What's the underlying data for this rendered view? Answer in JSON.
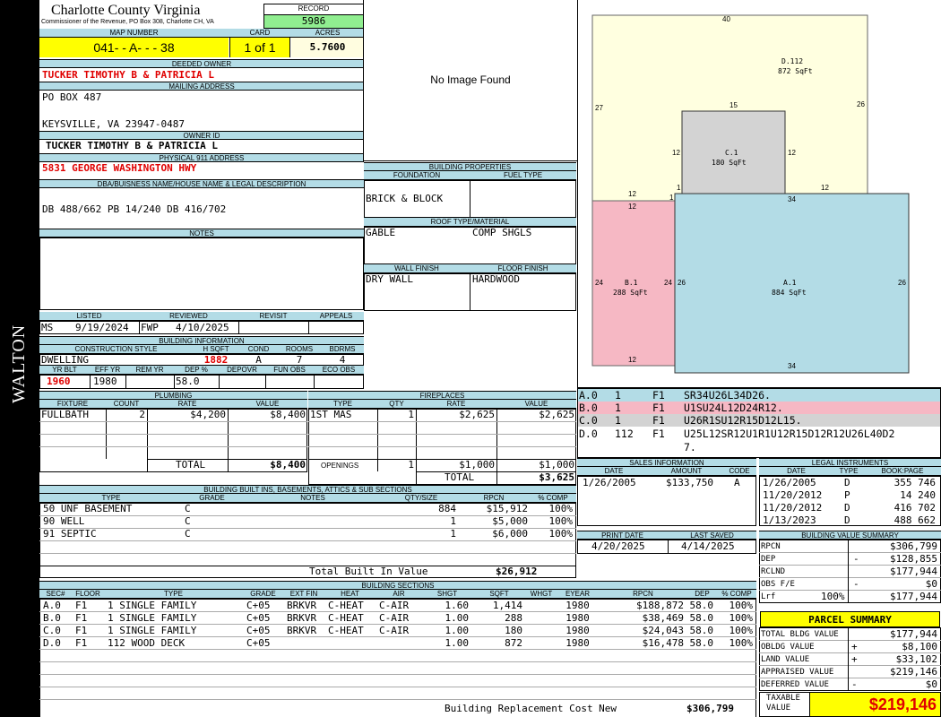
{
  "side_label": "WALTON",
  "header": {
    "county": "Charlotte County Virginia",
    "sub": "Commissioner of the Revenue, PO Box 308, Charlotte CH, VA",
    "record_label": "RECORD",
    "record": "5986"
  },
  "parcel": {
    "map_label": "MAP NUMBER",
    "map": "041- - A- - - 38",
    "card_label": "CARD",
    "card": "1 of 1",
    "acres_label": "ACRES",
    "acres": "5.7600"
  },
  "owner": {
    "deeded_label": "DEEDED OWNER",
    "deeded": "TUCKER TIMOTHY B & PATRICIA L",
    "mailing_label": "MAILING ADDRESS",
    "mail1": "PO BOX 487",
    "mail2": "KEYSVILLE, VA 23947-0487",
    "owner_id_label": "OWNER ID",
    "owner_id": "TUCKER TIMOTHY B & PATRICIA L",
    "phys_label": "PHYSICAL 911 ADDRESS",
    "phys": "5831 GEORGE WASHINGTON HWY",
    "dba_label": "DBA/BUISNESS NAME/HOUSE NAME & LEGAL DESCRIPTION",
    "dba": "DB 488/662 PB 14/240 DB 416/702",
    "notes_label": "NOTES"
  },
  "image": {
    "missing": "No Image Found"
  },
  "listing": {
    "listed_label": "LISTED",
    "reviewed_label": "REVIEWED",
    "revisit_label": "REVISIT",
    "appeals_label": "APPEALS",
    "listed_by": "MS",
    "listed_date": "9/19/2024",
    "reviewed_by": "FWP",
    "reviewed_date": "4/10/2025"
  },
  "bldg_info": {
    "title": "BUILDING INFORMATION",
    "h": [
      "CONSTRUCTION STYLE",
      "H SQFT",
      "COND",
      "ROOMS",
      "BDRMS"
    ],
    "style": "DWELLING",
    "sqft": "1882",
    "cond": "A",
    "rooms": "7",
    "bdrms": "4",
    "h2": [
      "YR BLT",
      "EFF YR",
      "REM YR",
      "DEP %",
      "DEPOVR",
      "FUN OBS",
      "ECO OBS"
    ],
    "yrblt": "1960",
    "effyr": "1980",
    "dep": "58.0"
  },
  "props": {
    "title": "BUILDING PROPERTIES",
    "foundation_label": "FOUNDATION",
    "fuel_label": "FUEL TYPE",
    "foundation": "BRICK & BLOCK",
    "roof_label": "ROOF TYPE/MATERIAL",
    "roof_type": "GABLE",
    "roof_mat": "COMP SHGLS",
    "wall_label": "WALL FINISH",
    "floor_label": "FLOOR FINISH",
    "wall": "DRY WALL",
    "floor": "HARDWOOD"
  },
  "sketch": {
    "D": {
      "label": "D.112",
      "area": "872 SqFt",
      "top": "40",
      "left": "27",
      "right": "26",
      "b1": "12",
      "b2": "12"
    },
    "C": {
      "label": "C.1",
      "area": "180 SqFt",
      "top": "15",
      "left": "12",
      "right": "12",
      "bl": "1"
    },
    "B": {
      "label": "B.1",
      "area": "288 SqFt",
      "top": "12",
      "left": "24",
      "right": "24",
      "bottom": "12",
      "tr": "1"
    },
    "A": {
      "label": "A.1",
      "area": "884 SqFt",
      "top": "34",
      "left": "26",
      "right": "26",
      "bottom": "34"
    }
  },
  "sections_list": [
    {
      "id": "A.0",
      "n": "1",
      "fl": "F1",
      "code": "SR34U26L34D26.",
      "bg": "#b3dce6"
    },
    {
      "id": "B.0",
      "n": "1",
      "fl": "F1",
      "code": "U1SU24L12D24R12.",
      "bg": "#f6b8c4"
    },
    {
      "id": "C.0",
      "n": "1",
      "fl": "F1",
      "code": "U26R1SU12R15D12L15.",
      "bg": "#d3d3d3"
    },
    {
      "id": "D.0",
      "n": "112",
      "fl": "F1",
      "code": "U25L12SR12U1R1U12R15D12R12U26L40D2",
      "code2": "7.",
      "bg": "#ffffff"
    }
  ],
  "plumbing": {
    "title": "PLUMBING",
    "h": [
      "FIXTURE",
      "COUNT",
      "RATE",
      "VALUE"
    ],
    "row": [
      "FULLBATH",
      "2",
      "$4,200",
      "$8,400"
    ],
    "total_label": "TOTAL",
    "total": "$8,400"
  },
  "fireplaces": {
    "title": "FIREPLACES",
    "h": [
      "TYPE",
      "QTY",
      "RATE",
      "VALUE"
    ],
    "row": [
      "1ST MAS",
      "1",
      "$2,625",
      "$2,625"
    ],
    "open_label": "OPENINGS",
    "open": [
      "1",
      "$1,000",
      "$1,000"
    ],
    "total_label": "TOTAL",
    "total": "$3,625"
  },
  "sales": {
    "title": "SALES INFORMATION",
    "h": [
      "DATE",
      "AMOUNT",
      "CODE"
    ],
    "row": [
      "1/26/2005",
      "$133,750",
      "A"
    ]
  },
  "legal": {
    "title": "LEGAL INSTRUMENTS",
    "h": [
      "DATE",
      "TYPE",
      "BOOK:PAGE"
    ],
    "rows": [
      [
        "1/26/2005",
        "D",
        "355 746"
      ],
      [
        "11/20/2012",
        "P",
        "14 240"
      ],
      [
        "11/20/2012",
        "D",
        "416 702"
      ],
      [
        "1/13/2023",
        "D",
        "488 662"
      ]
    ]
  },
  "builtins": {
    "title": "BUILDING BUILT INS, BASEMENTS, ATTICS & SUB SECTIONS",
    "h": [
      "TYPE",
      "GRADE",
      "NOTES",
      "QTY/SIZE",
      "RPCN",
      "% COMP"
    ],
    "rows": [
      [
        "50 UNF BASEMENT",
        "C",
        "",
        "884",
        "$15,912",
        "100%"
      ],
      [
        "90 WELL",
        "C",
        "",
        "1",
        "$5,000",
        "100%"
      ],
      [
        "91 SEPTIC",
        "C",
        "",
        "1",
        "$6,000",
        "100%"
      ]
    ],
    "total_label": "Total Built In Value",
    "total": "$26,912"
  },
  "dates": {
    "print_label": "PRINT DATE",
    "saved_label": "LAST SAVED",
    "print": "4/20/2025",
    "saved": "4/14/2025"
  },
  "bvs": {
    "title": "BUILDING VALUE SUMMARY",
    "rows": [
      {
        "label": "RPCN",
        "sign": "",
        "val": "$306,799"
      },
      {
        "label": "DEP",
        "sign": "-",
        "val": "$128,855"
      },
      {
        "label": "RCLND",
        "sign": "",
        "val": "$177,944"
      },
      {
        "label": "OBS F/E",
        "sign": "-",
        "val": "$0"
      },
      {
        "label": "Lrf",
        "pct": "100%",
        "sign": "",
        "val": "$177,944"
      }
    ]
  },
  "bsections": {
    "title": "BUILDING SECTIONS",
    "h": [
      "SEC#",
      "FLOOR",
      "TYPE",
      "GRADE",
      "EXT FIN",
      "HEAT",
      "AIR",
      "SHGT",
      "SQFT",
      "WHGT",
      "EYEAR",
      "RPCN",
      "DEP",
      "% COMP"
    ],
    "rows": [
      [
        "A.0",
        "F1",
        "1 SINGLE FAMILY",
        "C+05",
        "BRKVR",
        "C-HEAT",
        "C-AIR",
        "1.60",
        "1,414",
        "",
        "1980",
        "$188,872",
        "58.0",
        "100%"
      ],
      [
        "B.0",
        "F1",
        "1 SINGLE FAMILY",
        "C+05",
        "BRKVR",
        "C-HEAT",
        "C-AIR",
        "1.00",
        "288",
        "",
        "1980",
        "$38,469",
        "58.0",
        "100%"
      ],
      [
        "C.0",
        "F1",
        "1 SINGLE FAMILY",
        "C+05",
        "BRKVR",
        "C-HEAT",
        "C-AIR",
        "1.00",
        "180",
        "",
        "1980",
        "$24,043",
        "58.0",
        "100%"
      ],
      [
        "D.0",
        "F1",
        "112 WOOD DECK",
        "C+05",
        "",
        "",
        "",
        "1.00",
        "872",
        "",
        "1980",
        "$16,478",
        "58.0",
        "100%"
      ]
    ],
    "brcn_label": "Building Replacement Cost New",
    "brcn": "$306,799"
  },
  "summary": {
    "title": "PARCEL SUMMARY",
    "rows": [
      {
        "label": "TOTAL BLDG VALUE",
        "sign": "",
        "val": "$177,944"
      },
      {
        "label": "OBLDG VALUE",
        "sign": "+",
        "val": "$8,100"
      },
      {
        "label": "LAND VALUE",
        "sign": "+",
        "val": "$33,102"
      },
      {
        "label": "APPRAISED VALUE",
        "sign": "",
        "val": "$219,146"
      },
      {
        "label": "DEFERRED VALUE",
        "sign": "-",
        "val": "$0"
      }
    ],
    "taxable_label1": "TAXABLE",
    "taxable_label2": "VALUE",
    "taxable": "$219,146"
  }
}
